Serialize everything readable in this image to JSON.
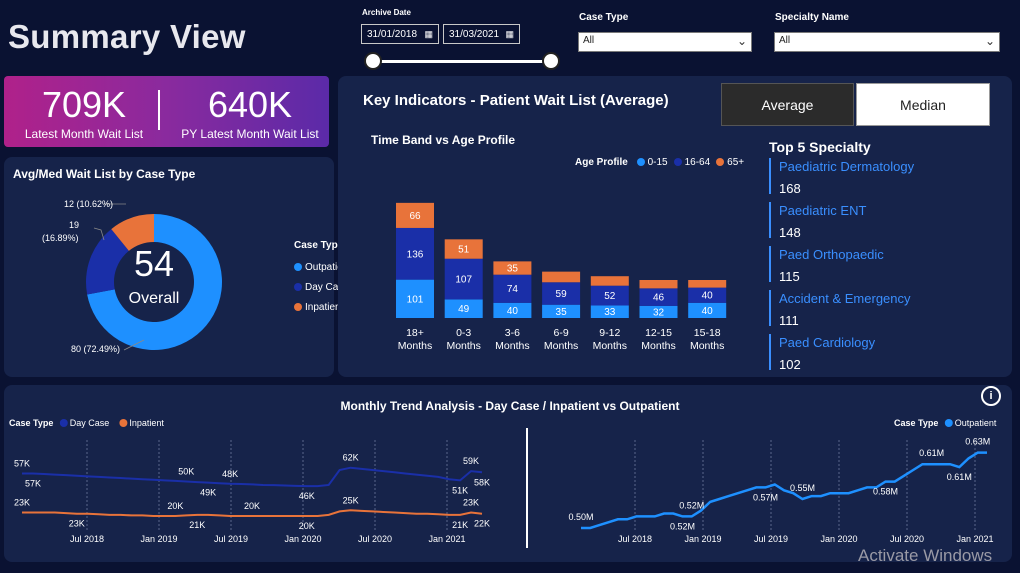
{
  "header": {
    "title": "Summary View"
  },
  "filters": {
    "archive_label": "Archive Date",
    "date_from": "31/01/2018",
    "date_to": "31/03/2021",
    "case_type_label": "Case Type",
    "case_type_value": "All",
    "specialty_label": "Specialty Name",
    "specialty_value": "All"
  },
  "kpi": {
    "current_value": "709K",
    "current_label": "Latest Month Wait List",
    "py_value": "640K",
    "py_label": "PY Latest Month Wait List"
  },
  "key_indicators": {
    "title": "Key Indicators - Patient Wait List (Average)",
    "toggle_average": "Average",
    "toggle_median": "Median"
  },
  "donut": {
    "title": "Avg/Med Wait List by Case Type",
    "center_value": "54",
    "center_label": "Overall",
    "legend_title": "Case Type",
    "labels": {
      "inpatient": "12 (10.62%)",
      "daycase_a": "19",
      "daycase_b": "(16.89%)",
      "outpatient": "80 (72.49%)"
    }
  },
  "bar": {
    "title": "Time Band vs Age Profile",
    "legend_title": "Age Profile"
  },
  "specialty": {
    "title": "Top 5 Specialty",
    "items": [
      {
        "name": "Paediatric Dermatology",
        "value": "168"
      },
      {
        "name": "Paediatric ENT",
        "value": "148"
      },
      {
        "name": "Paed Orthopaedic",
        "value": "115"
      },
      {
        "name": "Accident & Emergency",
        "value": "111"
      },
      {
        "name": "Paed Cardiology",
        "value": "102"
      }
    ]
  },
  "trend": {
    "title": "Monthly Trend Analysis - Day Case / Inpatient vs Outpatient",
    "info_icon": "info-icon"
  },
  "watermark": "Activate Windows",
  "chart_data": [
    {
      "type": "pie",
      "title": "Avg/Med Wait List by Case Type",
      "categories": [
        "Outpatient",
        "Day Case",
        "Inpatient"
      ],
      "values": [
        80,
        19,
        12
      ],
      "percents": [
        72.49,
        16.89,
        10.62
      ],
      "colors": [
        "#1e90ff",
        "#1a2fa8",
        "#e8733a"
      ],
      "legend_title": "Case Type"
    },
    {
      "type": "bar",
      "title": "Time Band vs Age Profile",
      "stacked": true,
      "categories": [
        "18+ Months",
        "0-3 Months",
        "3-6 Months",
        "6-9 Months",
        "9-12 Months",
        "12-15 Months",
        "15-18 Months"
      ],
      "series": [
        {
          "name": "0-15",
          "color": "#1e90ff",
          "values": [
            101,
            49,
            40,
            35,
            33,
            32,
            40
          ],
          "labels": [
            "101",
            "49",
            "40",
            "35",
            "33",
            "32",
            "40"
          ]
        },
        {
          "name": "16-64",
          "color": "#1a2fa8",
          "values": [
            136,
            107,
            74,
            59,
            52,
            46,
            40
          ],
          "labels": [
            "136",
            "107",
            "74",
            "59",
            "52",
            "46",
            "40"
          ]
        },
        {
          "name": "65+",
          "color": "#e8733a",
          "values": [
            66,
            51,
            35,
            28,
            25,
            22,
            20
          ],
          "labels": [
            "66",
            "51",
            "35",
            "",
            "",
            "",
            ""
          ]
        }
      ],
      "legend_title": "Age Profile",
      "legend_position": "top-right"
    },
    {
      "type": "line",
      "legend_title": "Case Type",
      "x_ticks": [
        "Jul 2018",
        "Jan 2019",
        "Jul 2019",
        "Jan 2020",
        "Jul 2020",
        "Jan 2021"
      ],
      "series": [
        {
          "name": "Day Case",
          "color": "#1a2fa8",
          "values": [
            57,
            57,
            56.5,
            56,
            55.5,
            55,
            54.5,
            54,
            53.5,
            53,
            52.5,
            52,
            51.5,
            51,
            50.5,
            50,
            49.5,
            49,
            48.5,
            48,
            47.8,
            47.5,
            47,
            46.8,
            46.5,
            46.2,
            46,
            46,
            47,
            60,
            62,
            61,
            60,
            59,
            58,
            57,
            56,
            55,
            54,
            52,
            51,
            59,
            58
          ],
          "point_labels": [
            {
              "i": 0,
              "t": "57K"
            },
            {
              "i": 1,
              "t": "57K"
            },
            {
              "i": 15,
              "t": "50K"
            },
            {
              "i": 17,
              "t": "49K"
            },
            {
              "i": 19,
              "t": "48K"
            },
            {
              "i": 26,
              "t": "46K"
            },
            {
              "i": 30,
              "t": "62K"
            },
            {
              "i": 40,
              "t": "51K"
            },
            {
              "i": 41,
              "t": "59K"
            },
            {
              "i": 42,
              "t": "58K"
            }
          ]
        },
        {
          "name": "Inpatient",
          "color": "#e8733a",
          "values": [
            23,
            23,
            23,
            23,
            22.5,
            22,
            22,
            21.5,
            21,
            21,
            20.5,
            20.5,
            20,
            20,
            20,
            20.5,
            21,
            21,
            20.5,
            20,
            20,
            20,
            20,
            20,
            20,
            20,
            20,
            20,
            21,
            24,
            25,
            24.5,
            24,
            23.5,
            23,
            22.5,
            22,
            22,
            21.5,
            21,
            21,
            23,
            22
          ],
          "point_labels": [
            {
              "i": 0,
              "t": "23K"
            },
            {
              "i": 5,
              "t": "23K"
            },
            {
              "i": 14,
              "t": "20K"
            },
            {
              "i": 16,
              "t": "21K"
            },
            {
              "i": 21,
              "t": "20K"
            },
            {
              "i": 26,
              "t": "20K"
            },
            {
              "i": 30,
              "t": "25K"
            },
            {
              "i": 40,
              "t": "21K"
            },
            {
              "i": 41,
              "t": "23K"
            },
            {
              "i": 42,
              "t": "22K"
            }
          ]
        }
      ]
    },
    {
      "type": "line",
      "legend_title": "Case Type",
      "x_ticks": [
        "Jul 2018",
        "Jan 2019",
        "Jul 2019",
        "Jan 2020",
        "Jul 2020",
        "Jan 2021"
      ],
      "series": [
        {
          "name": "Outpatient",
          "color": "#1e90ff",
          "values": [
            0.5,
            0.5,
            0.505,
            0.51,
            0.515,
            0.515,
            0.52,
            0.52,
            0.52,
            0.525,
            0.525,
            0.52,
            0.52,
            0.53,
            0.545,
            0.55,
            0.555,
            0.56,
            0.565,
            0.57,
            0.57,
            0.575,
            0.565,
            0.56,
            0.55,
            0.555,
            0.555,
            0.56,
            0.56,
            0.56,
            0.565,
            0.57,
            0.57,
            0.58,
            0.58,
            0.59,
            0.6,
            0.61,
            0.61,
            0.61,
            0.61,
            0.605,
            0.62,
            0.63,
            0.63
          ],
          "point_labels": [
            {
              "i": 0,
              "t": "0.50M"
            },
            {
              "i": 11,
              "t": "0.52M"
            },
            {
              "i": 12,
              "t": "0.52M"
            },
            {
              "i": 20,
              "t": "0.57M"
            },
            {
              "i": 24,
              "t": "0.55M"
            },
            {
              "i": 33,
              "t": "0.58M"
            },
            {
              "i": 38,
              "t": "0.61M"
            },
            {
              "i": 41,
              "t": "0.61M"
            },
            {
              "i": 43,
              "t": "0.63M"
            }
          ]
        }
      ]
    }
  ]
}
